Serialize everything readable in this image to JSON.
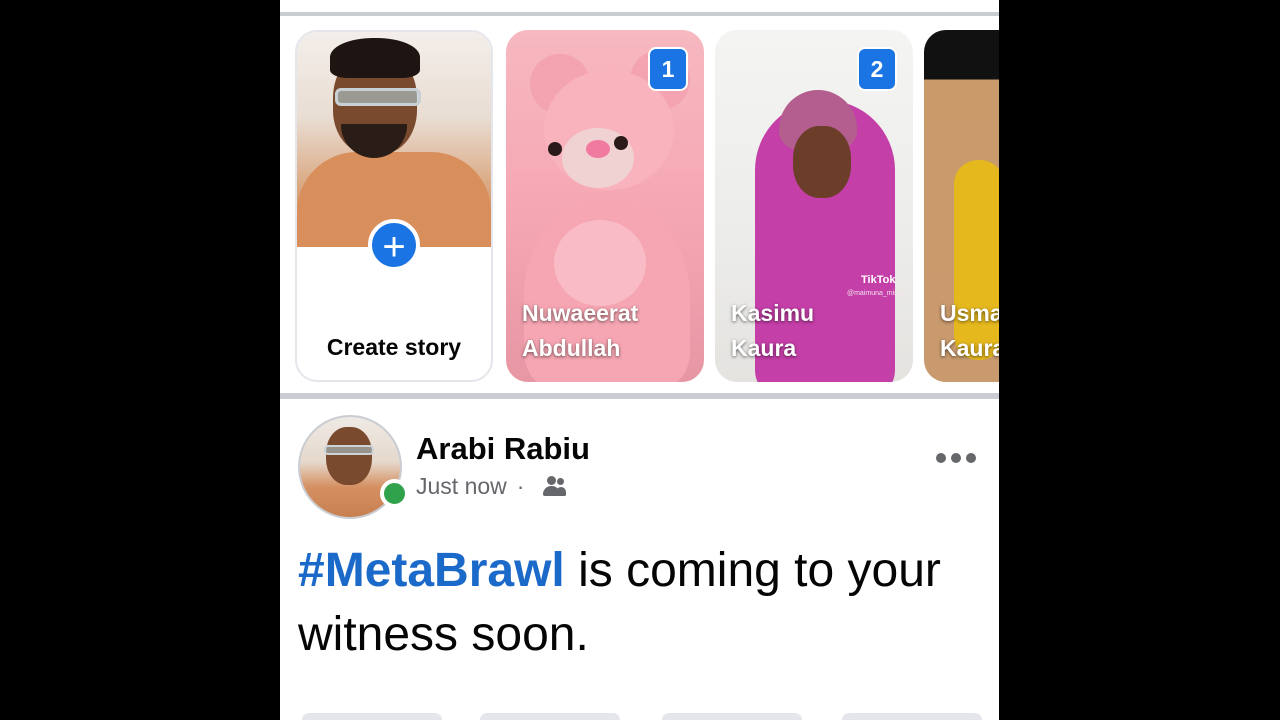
{
  "stories": {
    "create_label": "Create story",
    "cards": [
      {
        "name_line1": "Nuwaeerat",
        "name_line2": "Abdullah",
        "badge": "1"
      },
      {
        "name_line1": "Kasimu",
        "name_line2": "Kaura",
        "badge": "2",
        "watermark": "TikTok",
        "watermark_handle": "@maimuna_misau"
      },
      {
        "name_line1": "Usman",
        "name_line2": "Kaura"
      }
    ]
  },
  "post": {
    "author": "Arabi Rabiu",
    "time": "Just now",
    "separator": "·",
    "privacy_icon": "friends-icon",
    "hashtag": "#MetaBrawl",
    "body": " is coming to your witness soon."
  },
  "colors": {
    "accent": "#1b74e4",
    "hashtag": "#1b6ac9",
    "online": "#31a24c",
    "divider": "#c9ccd1"
  }
}
